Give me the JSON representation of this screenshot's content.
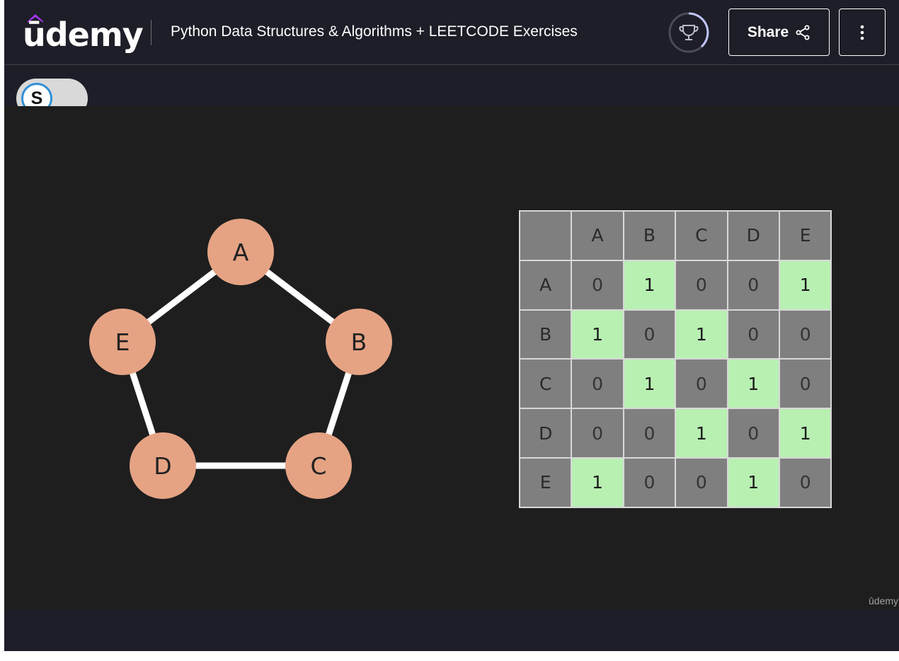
{
  "header": {
    "logo_text": "ūdemy",
    "course_title": "Python Data Structures & Algorithms + LEETCODE Exercises",
    "share_label": "Share",
    "brand_color": "#a435f0",
    "progress_icon": "trophy-icon"
  },
  "toggle": {
    "label": "S",
    "ring_color": "#2f8fd8"
  },
  "graph": {
    "node_color": "#e5a384",
    "edge_color": "#ffffff",
    "nodes": [
      "A",
      "B",
      "C",
      "D",
      "E"
    ],
    "edges": [
      [
        "A",
        "B"
      ],
      [
        "B",
        "C"
      ],
      [
        "C",
        "D"
      ],
      [
        "D",
        "E"
      ],
      [
        "E",
        "A"
      ]
    ]
  },
  "matrix": {
    "columns": [
      "A",
      "B",
      "C",
      "D",
      "E"
    ],
    "rows": [
      {
        "label": "A",
        "values": [
          "0",
          "1",
          "0",
          "0",
          "1"
        ]
      },
      {
        "label": "B",
        "values": [
          "1",
          "0",
          "1",
          "0",
          "0"
        ]
      },
      {
        "label": "C",
        "values": [
          "0",
          "1",
          "0",
          "1",
          "0"
        ]
      },
      {
        "label": "D",
        "values": [
          "0",
          "0",
          "1",
          "0",
          "1"
        ]
      },
      {
        "label": "E",
        "values": [
          "1",
          "0",
          "0",
          "1",
          "0"
        ]
      }
    ],
    "highlight_color": "#b8f0b2",
    "cell_color": "#7f7f7f"
  },
  "watermark": "ûdemy"
}
